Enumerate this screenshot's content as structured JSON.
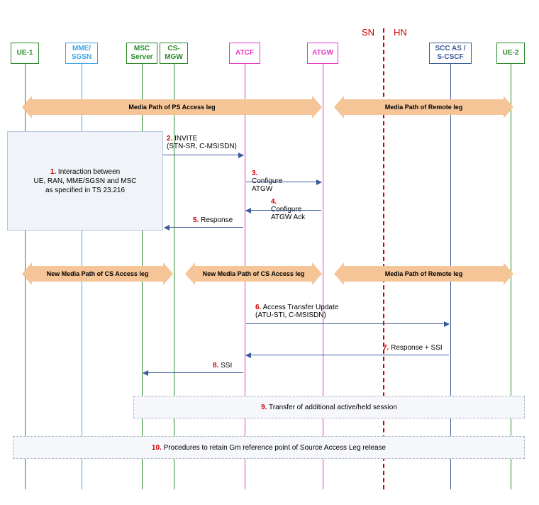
{
  "domain_labels": {
    "sn": "SN",
    "hn": "HN"
  },
  "actors": {
    "ue1": "UE-1",
    "mme": "MME/\nSGSN",
    "msc": "MSC\nServer",
    "csmgw": "CS-\nMGW",
    "atcf": "ATCF",
    "atgw": "ATGW",
    "scc": "SCC AS /\nS-CSCF",
    "ue2": "UE-2"
  },
  "bars": {
    "ps_access": "Media Path of PS Access leg",
    "remote1": "Media Path of Remote leg",
    "cs_access_1": "New Media Path of CS Access leg",
    "cs_access_2": "New Media Path of CS Access leg",
    "remote2": "Media Path of Remote leg"
  },
  "steps": {
    "s1_num": "1.",
    "s1": "Interaction between\nUE, RAN, MME/SGSN and MSC\nas specified in TS 23.216",
    "s2_num": "2.",
    "s2a": "INVITE",
    "s2b": "(STN-SR, C-MSISDN)",
    "s3_num": "3.",
    "s3": "Configure\nATGW",
    "s4_num": "4.",
    "s4": "Configure\nATGW Ack",
    "s5_num": "5.",
    "s5": "Response",
    "s6_num": "6.",
    "s6a": "Access Transfer Update",
    "s6b": "(ATU-STI, C-MSISDN)",
    "s7_num": "7.",
    "s7": "Response + SSI",
    "s8_num": "8.",
    "s8": "SSI",
    "s9_num": "9.",
    "s9": "Transfer of additional active/held session",
    "s10_num": "10.",
    "s10": "Procedures to retain Gm reference point of Source Access Leg release"
  },
  "positions": {
    "ue1": 35,
    "mme": 115,
    "msc": 200,
    "csmgw": 245,
    "atcf": 345,
    "atgw": 455,
    "scc": 635,
    "ue2": 720,
    "divider": 540
  }
}
